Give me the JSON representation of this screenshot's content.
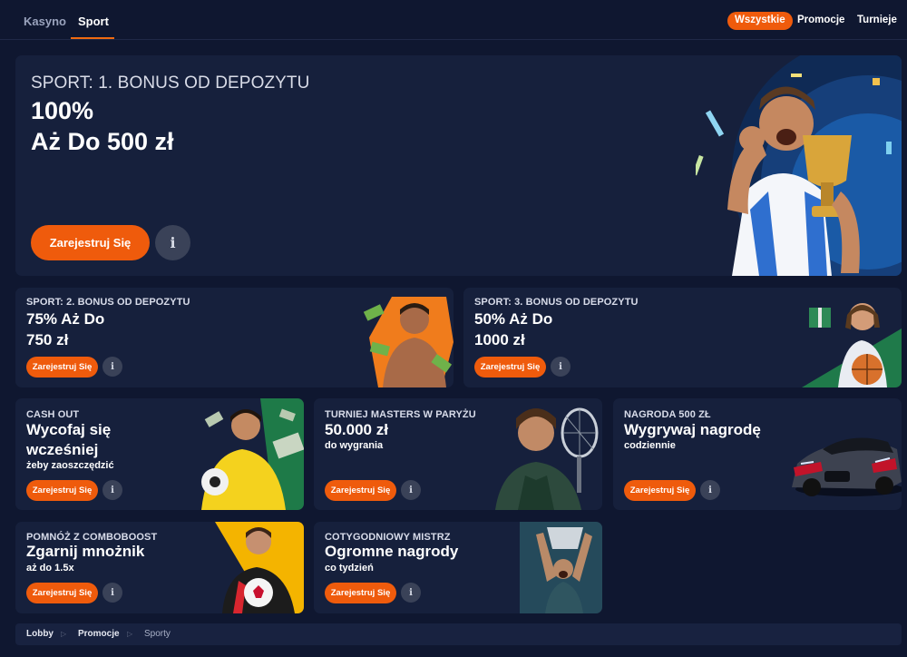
{
  "nav": {
    "tabs": [
      {
        "label": "Kasyno"
      },
      {
        "label": "Sport"
      }
    ],
    "filters": [
      {
        "label": "Wszystkie"
      },
      {
        "label": "Promocje"
      },
      {
        "label": "Turnieje"
      }
    ]
  },
  "hero": {
    "kicker": "SPORT: 1. BONUS OD DEPOZYTU",
    "line1": "100%",
    "line2": "Aż Do 500 zł",
    "button": "Zarejestruj Się",
    "info_icon": "info-icon"
  },
  "cards": [
    {
      "kicker": "SPORT: 2. BONUS OD DEPOZYTU",
      "title1": "75% Aż Do",
      "title2": "750 zł",
      "button": "Zarejestruj Się"
    },
    {
      "kicker": "SPORT: 3. BONUS OD DEPOZYTU",
      "title1": "50% Aż Do",
      "title2": "1000 zł",
      "button": "Zarejestruj Się"
    },
    {
      "kicker": "CASH OUT",
      "title1": "Wycofaj się",
      "title2": "wcześniej",
      "sub": "żeby zaoszczędzić",
      "button": "Zarejestruj Się"
    },
    {
      "kicker": "TURNIEJ MASTERS W PARYŻU",
      "title1": "50.000 zł",
      "sub": "do wygrania",
      "button": "Zarejestruj Się"
    },
    {
      "kicker": "NAGRODA 500 ZŁ",
      "title1": "Wygrywaj nagrodę",
      "sub": "codziennie",
      "button": "Zarejestruj Się"
    },
    {
      "kicker": "POMNÓŻ Z COMBOBOOST",
      "title1": "Zgarnij mnożnik",
      "sub": "aż do 1.5x",
      "button": "Zarejestruj Się"
    },
    {
      "kicker": "COTYGODNIOWY MISTRZ",
      "title1": "Ogromne nagrody",
      "sub": "co tydzień",
      "button": "Zarejestruj Się"
    }
  ],
  "breadcrumb": [
    {
      "label": "Lobby"
    },
    {
      "label": "Promocje"
    },
    {
      "label": "Sporty"
    }
  ],
  "colors": {
    "background": "#0f1730",
    "card": "#16203c",
    "accent": "#ef5b0c",
    "info_button": "#3a4258"
  }
}
